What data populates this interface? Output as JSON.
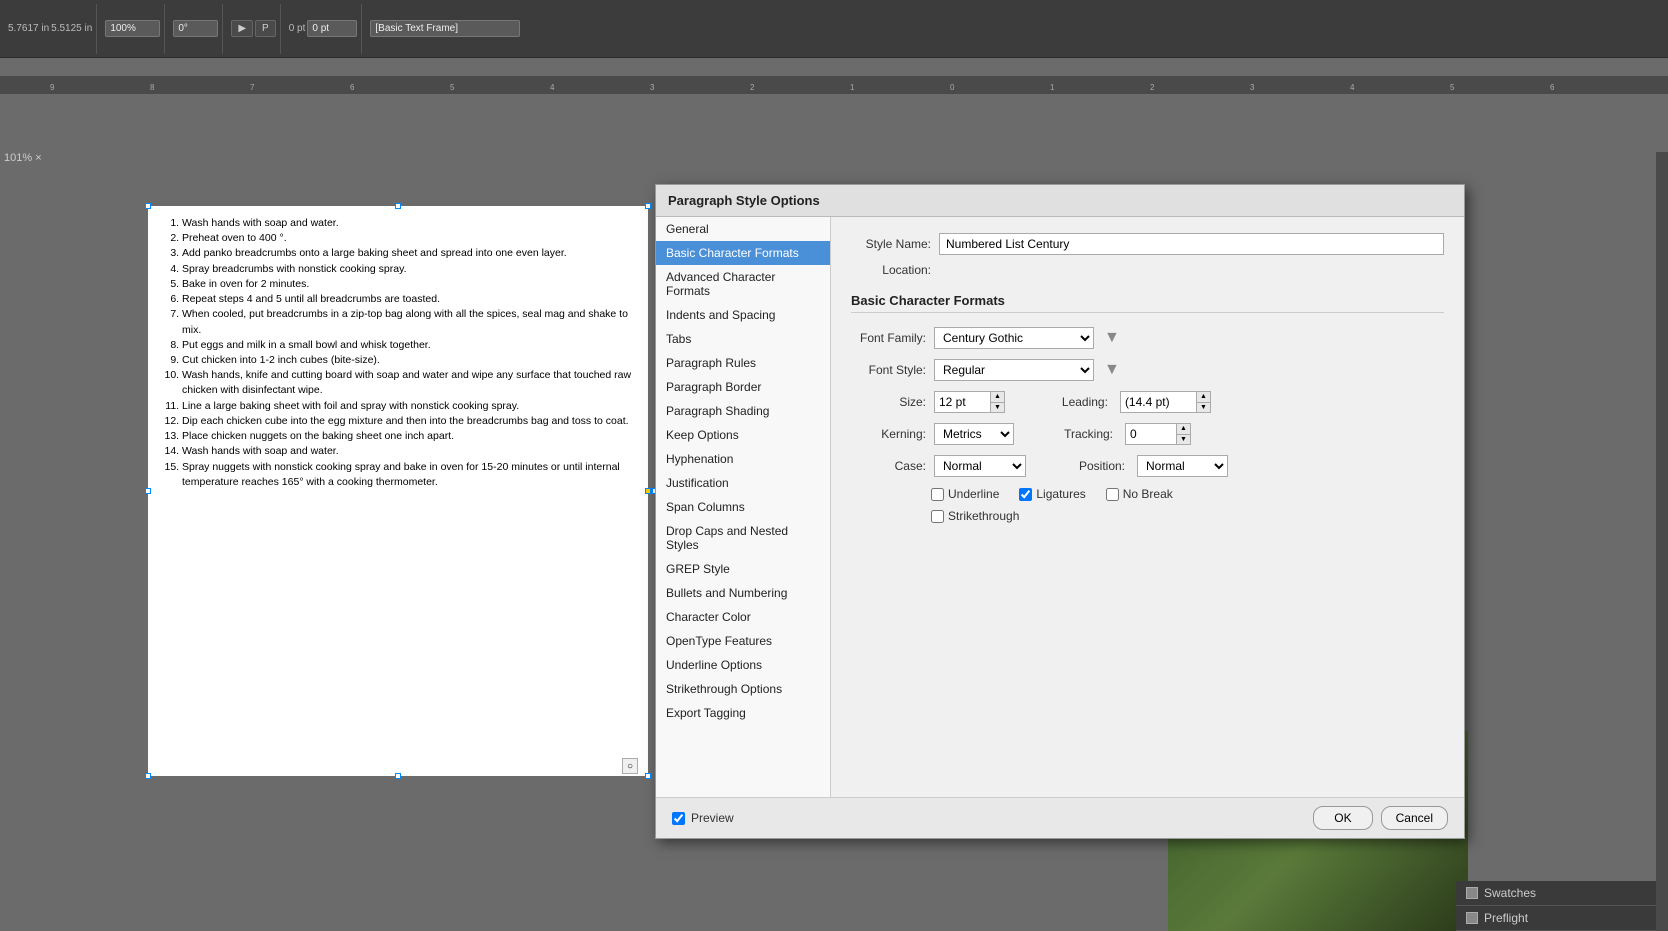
{
  "app": {
    "zoom": "101%",
    "coords": "5.7617 in",
    "coords2": "5.5125 in"
  },
  "toolbar": {
    "zoom_label": "100%",
    "rotation": "0°",
    "frame_type": "[Basic Text Frame]"
  },
  "document": {
    "items": [
      "Wash hands with soap and water.",
      "Preheat oven to 400 °.",
      "Add panko breadcrumbs onto a large baking sheet and spread into one even layer.",
      "Spray breadcrumbs with nonstick cooking spray.",
      "Bake in oven for 2 minutes.",
      "Repeat steps 4 and 5 until all breadcrumbs are toasted.",
      "When cooled, put breadcrumbs in a zip-top bag along with all the spices, seal mag and shake to mix.",
      "Put eggs and milk in a small bowl and whisk together.",
      "Cut chicken into 1-2 inch cubes (bite-size).",
      "Wash hands, knife and cutting board with soap and water and wipe any surface that touched raw chicken with disinfectant wipe.",
      "Line a large baking sheet with foil and spray with nonstick cooking spray.",
      "Dip each chicken cube into the egg mixture and then into the breadcrumbs bag and toss to coat.",
      "Place chicken nuggets on the baking sheet one inch apart.",
      "Wash hands with soap and water.",
      "Spray nuggets with nonstick cooking spray and bake in oven for 15-20 minutes or until internal temperature reaches 165° with a cooking thermometer."
    ]
  },
  "dialog": {
    "title": "Paragraph Style Options",
    "style_name_label": "Style Name:",
    "style_name_value": "Numbered List Century",
    "location_label": "Location:",
    "location_value": "",
    "section_heading": "Basic Character Formats",
    "font_family_label": "Font Family:",
    "font_family_value": "Century Gothic",
    "font_style_label": "Font Style:",
    "font_style_value": "Regular",
    "size_label": "Size:",
    "size_value": "12 pt",
    "leading_label": "Leading:",
    "leading_value": "(14.4 pt)",
    "kerning_label": "Kerning:",
    "kerning_value": "Metrics",
    "tracking_label": "Tracking:",
    "tracking_value": "0",
    "case_label": "Case:",
    "case_value": "Normal",
    "position_label": "Position:",
    "position_value": "Normal",
    "underline_label": "Underline",
    "ligatures_label": "Ligatures",
    "no_break_label": "No Break",
    "strikethrough_label": "Strikethrough",
    "underline_checked": false,
    "ligatures_checked": true,
    "no_break_checked": false,
    "strikethrough_checked": false,
    "preview_label": "Preview",
    "preview_checked": true,
    "ok_label": "OK",
    "cancel_label": "Cancel"
  },
  "nav_items": [
    {
      "id": "general",
      "label": "General",
      "active": false
    },
    {
      "id": "basic-character-formats",
      "label": "Basic Character Formats",
      "active": true
    },
    {
      "id": "advanced-character-formats",
      "label": "Advanced Character Formats",
      "active": false
    },
    {
      "id": "indents-and-spacing",
      "label": "Indents and Spacing",
      "active": false
    },
    {
      "id": "tabs",
      "label": "Tabs",
      "active": false
    },
    {
      "id": "paragraph-rules",
      "label": "Paragraph Rules",
      "active": false
    },
    {
      "id": "paragraph-border",
      "label": "Paragraph Border",
      "active": false
    },
    {
      "id": "paragraph-shading",
      "label": "Paragraph Shading",
      "active": false
    },
    {
      "id": "keep-options",
      "label": "Keep Options",
      "active": false
    },
    {
      "id": "hyphenation",
      "label": "Hyphenation",
      "active": false
    },
    {
      "id": "justification",
      "label": "Justification",
      "active": false
    },
    {
      "id": "span-columns",
      "label": "Span Columns",
      "active": false
    },
    {
      "id": "drop-caps-and-nested-styles",
      "label": "Drop Caps and Nested Styles",
      "active": false
    },
    {
      "id": "grep-style",
      "label": "GREP Style",
      "active": false
    },
    {
      "id": "bullets-and-numbering",
      "label": "Bullets and Numbering",
      "active": false
    },
    {
      "id": "character-color",
      "label": "Character Color",
      "active": false
    },
    {
      "id": "opentype-features",
      "label": "OpenType Features",
      "active": false
    },
    {
      "id": "underline-options",
      "label": "Underline Options",
      "active": false
    },
    {
      "id": "strikethrough-options",
      "label": "Strikethrough Options",
      "active": false
    },
    {
      "id": "export-tagging",
      "label": "Export Tagging",
      "active": false
    }
  ],
  "panels": {
    "swatches_label": "Swatches",
    "preflight_label": "Preflight"
  }
}
